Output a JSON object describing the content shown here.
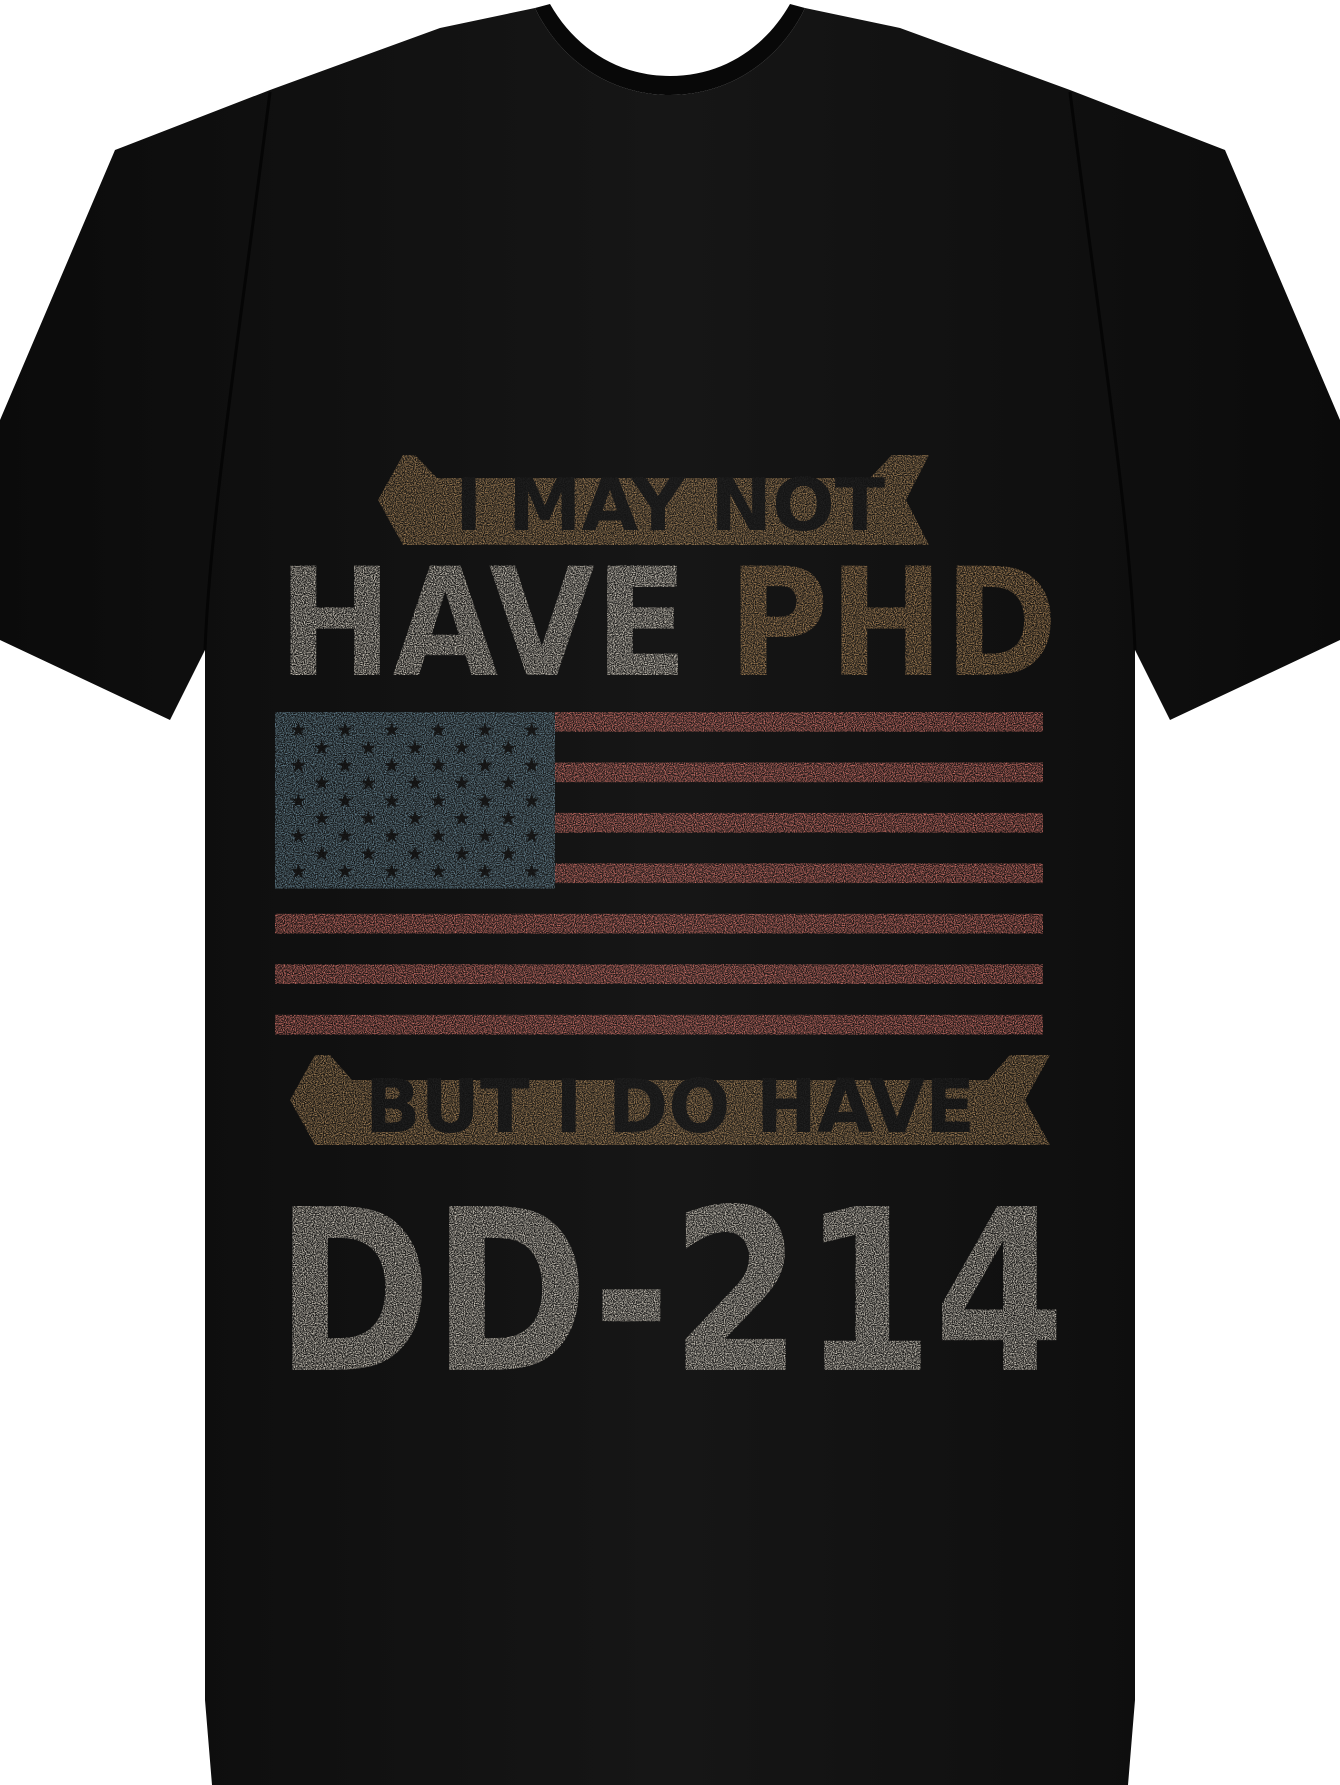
{
  "product": {
    "garment": "T-shirt",
    "shirt_color": "#121212",
    "background_color": "#ffffff"
  },
  "design": {
    "banner_top": {
      "text": "I MAY NOT",
      "color": "#b48d5d",
      "text_color": "#232323"
    },
    "line_2": {
      "word_1": "HAVE",
      "word_2": "PHD",
      "word_1_color": "#e6dfd1",
      "word_2_color": "#b88e5c"
    },
    "flag": {
      "name": "American flag",
      "canton_color": "#6d8e9e",
      "stripe_color": "#e27a70",
      "stripes": 13,
      "star_rows": 9,
      "style": "distressed"
    },
    "banner_bottom": {
      "text": "BUT I DO HAVE",
      "color": "#b48d5d",
      "text_color": "#232323"
    },
    "line_5": {
      "text": "DD-214",
      "color": "#e6dfd1"
    }
  }
}
